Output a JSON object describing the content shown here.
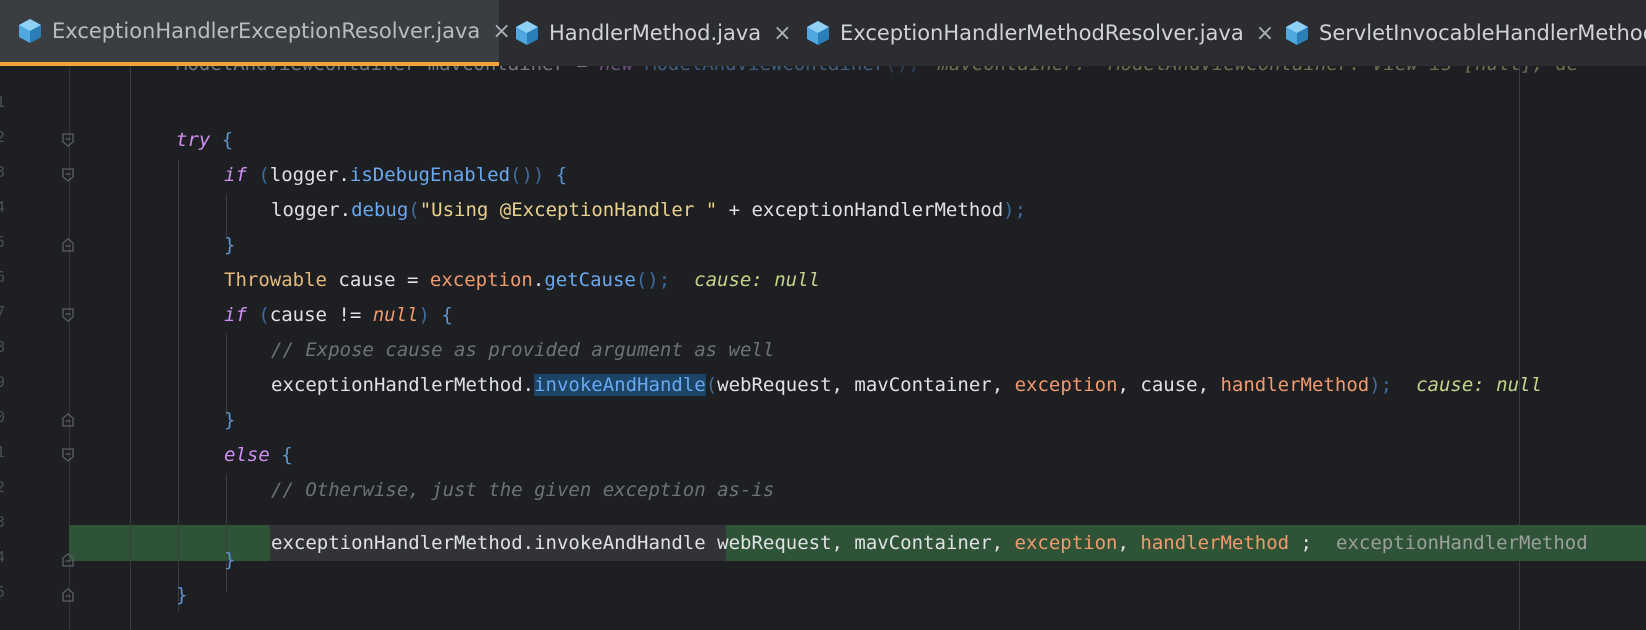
{
  "tabs": [
    {
      "label": "ExceptionHandlerExceptionResolver.java",
      "active": true,
      "closable": true
    },
    {
      "label": "HandlerMethod.java",
      "active": false,
      "closable": true
    },
    {
      "label": "ExceptionHandlerMethodResolver.java",
      "active": false,
      "closable": true
    },
    {
      "label": "ServletInvocableHandlerMethod.java",
      "active": false,
      "closable": false
    }
  ],
  "close_glyph": "×",
  "icon": "java-class-icon",
  "colors": {
    "accent": "#f2a43a",
    "execution_line": "#2e5337",
    "selection": "#1b4466"
  },
  "editor": {
    "line_numbers": [
      "0",
      "1",
      "2",
      "3",
      "4",
      "5",
      "6",
      "7",
      "8",
      "9",
      "0",
      "1",
      "2",
      "3",
      "4",
      "5"
    ],
    "lines": {
      "l0": {
        "a": "ModelAndViewContainer mavContainer = ",
        "b": "new ",
        "c": "ModelAndViewContainer",
        "d": "();",
        "hint": "mavContainer: \"ModelAndViewContainer: View is [null]; de"
      },
      "l2": {
        "kw": "try",
        "brace": " {"
      },
      "l3": {
        "kw": "if",
        "a": " (",
        "b": "logger",
        "c": ".",
        "fn": "isDebugEnabled",
        "d": "()) ",
        "brace": "{"
      },
      "l4": {
        "a": "logger.",
        "fn": "debug",
        "b": "(",
        "str": "\"Using @ExceptionHandler \"",
        "c": " + exceptionHandlerMethod",
        "d": ");"
      },
      "l5": {
        "brace": "}"
      },
      "l6": {
        "cls": "Throwable",
        "a": " cause = ",
        "fld": "exception",
        "b": ".",
        "fn": "getCause",
        "c": "();",
        "hint": "cause: null"
      },
      "l7": {
        "kw": "if",
        "a": " (",
        "b": "cause != ",
        "nul": "null",
        "c": ") ",
        "brace": "{"
      },
      "l8": {
        "com": "// Expose cause as provided argument as well"
      },
      "l9": {
        "a": "exceptionHandlerMethod.",
        "fn": "invokeAndHandle",
        "b": "(",
        "c": "webRequest, mavContainer, ",
        "fld1": "exception",
        "d": ", cause, ",
        "fld2": "handlerMethod",
        "e": ");",
        "hint": "cause: null"
      },
      "l10": {
        "brace": "}"
      },
      "l11": {
        "kw": "else",
        "brace": " {"
      },
      "l12": {
        "com": "// Otherwise, just the given exception as-is"
      },
      "l13": {
        "a": "exceptionHandlerMethod.invokeAndHandle",
        "b": " webRequest, mavContainer, ",
        "fld1": "exception",
        "c": ", ",
        "fld2": "handlerMethod",
        "d": " ;",
        "hint": "exceptionHandlerMethod"
      },
      "l14": {
        "brace": "}"
      },
      "l15": {
        "brace": "}"
      }
    }
  }
}
